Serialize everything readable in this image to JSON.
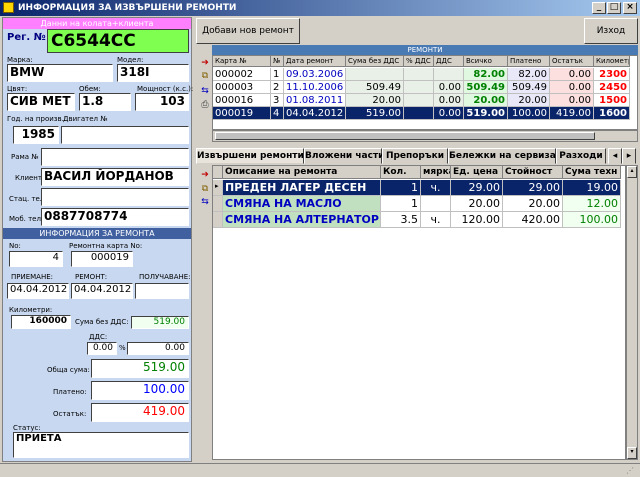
{
  "window": {
    "title": "ИНФОРМАЦИЯ ЗА ИЗВЪРШЕНИ РЕМОНТИ"
  },
  "client": {
    "section_title": "Данни на колата+клиента",
    "reg_label": "Рег. №",
    "reg_value": "C6544CC",
    "make_label": "Марка:",
    "make_value": "BMW",
    "model_label": "Модел:",
    "model_value": "318I",
    "color_label": "Цвят:",
    "color_value": "СИВ МЕТ",
    "volume_label": "Обем:",
    "volume_value": "1.8",
    "power_label": "Мощност (к.с.):",
    "power_value": "103",
    "year_label": "Год. на произв.:",
    "year_value": "1985",
    "engine_label": "Двигател №",
    "engine_value": "",
    "frame_label": "Рама №",
    "frame_value": "",
    "client_label": "Клиент:",
    "client_value": "ВАСИЛ ЙОРДАНОВ",
    "landline_label": "Стац. тел.:",
    "landline_value": "",
    "mobile_label": "Моб. тел.:",
    "mobile_value": "0887708774"
  },
  "repair": {
    "section_title": "ИНФОРМАЦИЯ ЗА РЕМОНТА",
    "no_label": "No:",
    "no_value": "4",
    "card_label": "Ремонтна карта No:",
    "card_value": "000019",
    "intake_label": "ПРИЕМАНЕ:",
    "intake_value": "04.04.2012",
    "repair_label": "РЕМОНТ:",
    "repair_value": "04.04.2012",
    "pickup_label": "ПОЛУЧАВАНЕ:",
    "pickup_value": "",
    "km_label": "Километри:",
    "km_value": "160000",
    "net_label": "Сума без ДДС:",
    "net_value": "519.00",
    "vat_label": "ДДС:",
    "vat_value": "0.00",
    "vat_pct_sign": "%",
    "vat_amount": "0.00",
    "total_label": "Обща сума:",
    "total_value": "519.00",
    "paid_label": "Платено:",
    "paid_value": "100.00",
    "rest_label": "Остатък:",
    "rest_value": "419.00",
    "status_label": "Статус:",
    "status_value": "ПРИЕТА"
  },
  "toolbar": {
    "add_label": "Добави нов ремонт",
    "exit_label": "Изход"
  },
  "repairs_grid": {
    "title": "РЕМОНТИ",
    "headers": [
      "Карта №",
      "№",
      "Дата ремонт",
      "Сума без ДДС",
      "% ДДС",
      "ДДС",
      "Всичко",
      "Платено",
      "Остатък",
      "Километр"
    ],
    "rows": [
      [
        "000002",
        "1",
        "09.03.2006",
        "",
        "",
        "",
        "82.00",
        "82.00",
        "0.00",
        "2300"
      ],
      [
        "000003",
        "2",
        "11.10.2006",
        "509.49",
        "",
        "0.00",
        "509.49",
        "509.49",
        "0.00",
        "2450"
      ],
      [
        "000016",
        "3",
        "01.08.2011",
        "20.00",
        "",
        "0.00",
        "20.00",
        "20.00",
        "0.00",
        "1500"
      ],
      [
        "000019",
        "4",
        "04.04.2012",
        "519.00",
        "",
        "0.00",
        "519.00",
        "100.00",
        "419.00",
        "1600"
      ]
    ]
  },
  "tabs": [
    "Извършени ремонти",
    "Вложени части",
    "Препоръки",
    "Бележки на сервиза",
    "Разходи"
  ],
  "work_grid": {
    "headers": [
      "Описание на ремонта",
      "Кол.",
      "мярка",
      "Ед. цена",
      "Стойност",
      "Сума техн"
    ],
    "rows": [
      [
        "ПРЕДЕН ЛАГЕР ДЕСЕН",
        "1",
        "ч.",
        "29.00",
        "29.00",
        "19.00"
      ],
      [
        "СМЯНА НА МАСЛО",
        "1",
        "",
        "20.00",
        "20.00",
        "12.00"
      ],
      [
        "СМЯНА НА АЛТЕРНАТОР",
        "3.5",
        "ч.",
        "120.00",
        "420.00",
        "100.00"
      ]
    ]
  },
  "colors": {
    "reg_bg": "#7fff4f",
    "selected_row": "#0a246a",
    "total": "#008000",
    "paid": "#0000ff",
    "rest": "#ff0000"
  }
}
